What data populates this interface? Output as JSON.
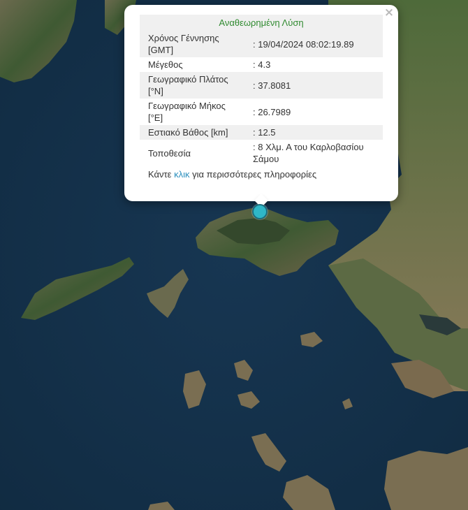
{
  "popup": {
    "title": "Αναθεωρημένη Λύση",
    "rows": [
      {
        "label": "Χρόνος Γέννησης [GMT]",
        "value": ": 19/04/2024 08:02:19.89"
      },
      {
        "label": "Μέγεθος",
        "value": ": 4.3"
      },
      {
        "label": "Γεωγραφικό Πλάτος [°N]",
        "value": ": 37.8081"
      },
      {
        "label": "Γεωγραφικό Μήκος [°E]",
        "value": ": 26.7989"
      },
      {
        "label": "Εστιακό Βάθος [km]",
        "value": ": 12.5"
      },
      {
        "label": "Τοποθεσία",
        "value": ": 8 Χλμ. Α του Καρλοβασίου Σάμου"
      }
    ],
    "more_prefix": "Κάντε",
    "more_link": "κλικ",
    "more_suffix": "για περισσότερες πληροφορίες",
    "close_symbol": "×"
  },
  "map": {
    "marker_color": "#2fb7c7",
    "sea_color": "#13304a",
    "land_color": "#4a5b3b"
  }
}
